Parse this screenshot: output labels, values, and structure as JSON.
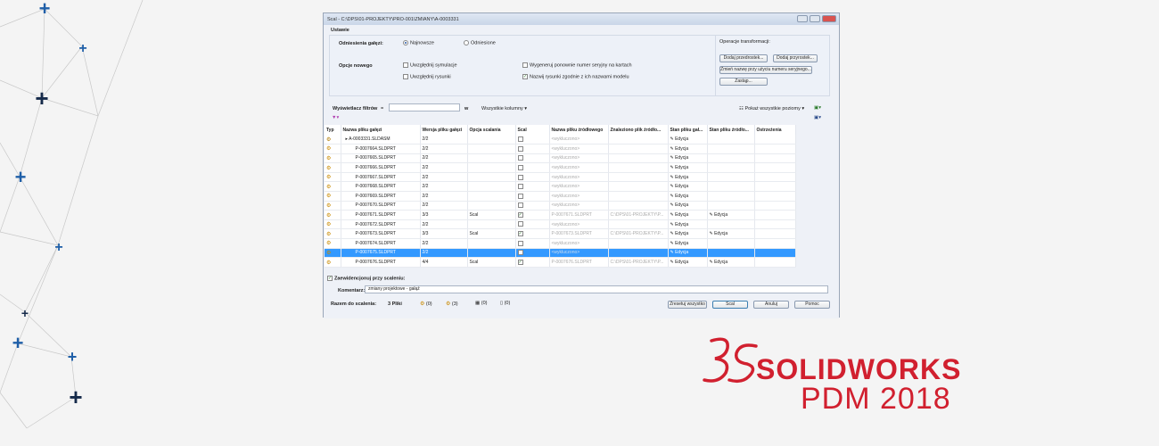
{
  "window": {
    "title": "Scal - C:\\DPS\\01-PROJEKTY\\PRO-001\\ZMIANY\\A-0003331"
  },
  "settings": {
    "header": "Ustawie",
    "branch_refs_label": "Odniesienia gałęzi:",
    "radio_latest": "Najnowsze",
    "radio_referenced": "Odniesione",
    "new_options_label": "Opcje nowego",
    "include_sim": "Uwzględnij symulacje",
    "include_drawings": "Uwzględnij rysunki",
    "regen_serial": "Wygeneruj ponownie numer seryjny na kartach",
    "name_drawings": "Nazwij rysunki zgodnie z ich nazwami modelu",
    "name_drawings_checked": true,
    "transform_label": "Operacje transformacji:",
    "add_prefix": "Dodaj przedrostek...",
    "add_suffix": "Dodaj przyrostek...",
    "rename_serial": "Zmień nazwę przy użyciu numeru seryjnego...",
    "replace": "Zastąp..."
  },
  "filter": {
    "label": "Wyświetlacz filtrów",
    "operator": "=",
    "value": "",
    "in_label": "w",
    "columns": "Wszystkie kolumny ▾",
    "show_levels": "Pokaż wszystkie poziomy ▾"
  },
  "table": {
    "headers": [
      "Typ",
      "Nazwa pliku gałęzi",
      "Wersja pliku gałęzi",
      "Opcja scalania",
      "Scal",
      "Nazwa pliku źródłowego",
      "Znaleziono plik źródło...",
      "Stan pliku gał...",
      "Stan pliku źródło...",
      "Ostrzeżenia"
    ],
    "rows": [
      {
        "name": "▸ A-0003331.SLDASM",
        "ver": "2/2",
        "opt": "",
        "merge": false,
        "src": "<wykluczono>",
        "found": "",
        "state": "Edycja",
        "srcstate": "",
        "asm": true
      },
      {
        "name": "P-0007664.SLDPRT",
        "ver": "2/2",
        "opt": "",
        "merge": false,
        "src": "<wykluczono>",
        "found": "",
        "state": "Edycja",
        "srcstate": ""
      },
      {
        "name": "P-0007665.SLDPRT",
        "ver": "2/2",
        "opt": "",
        "merge": false,
        "src": "<wykluczono>",
        "found": "",
        "state": "Edycja",
        "srcstate": ""
      },
      {
        "name": "P-0007666.SLDPRT",
        "ver": "2/2",
        "opt": "",
        "merge": false,
        "src": "<wykluczono>",
        "found": "",
        "state": "Edycja",
        "srcstate": ""
      },
      {
        "name": "P-0007667.SLDPRT",
        "ver": "2/2",
        "opt": "",
        "merge": false,
        "src": "<wykluczono>",
        "found": "",
        "state": "Edycja",
        "srcstate": ""
      },
      {
        "name": "P-0007668.SLDPRT",
        "ver": "2/2",
        "opt": "",
        "merge": false,
        "src": "<wykluczono>",
        "found": "",
        "state": "Edycja",
        "srcstate": ""
      },
      {
        "name": "P-0007669.SLDPRT",
        "ver": "2/2",
        "opt": "",
        "merge": false,
        "src": "<wykluczono>",
        "found": "",
        "state": "Edycja",
        "srcstate": ""
      },
      {
        "name": "P-0007670.SLDPRT",
        "ver": "2/2",
        "opt": "",
        "merge": false,
        "src": "<wykluczono>",
        "found": "",
        "state": "Edycja",
        "srcstate": ""
      },
      {
        "name": "P-0007671.SLDPRT",
        "ver": "3/3",
        "opt": "Scal",
        "merge": true,
        "src": "P-0007671.SLDPRT",
        "found": "C:\\DPS\\01-PROJEKTY\\P...",
        "state": "Edycja",
        "srcstate": "Edycja"
      },
      {
        "name": "P-0007672.SLDPRT",
        "ver": "2/2",
        "opt": "",
        "merge": false,
        "src": "<wykluczono>",
        "found": "",
        "state": "Edycja",
        "srcstate": ""
      },
      {
        "name": "P-0007673.SLDPRT",
        "ver": "3/3",
        "opt": "Scal",
        "merge": true,
        "src": "P-0007673.SLDPRT",
        "found": "C:\\DPS\\01-PROJEKTY\\P...",
        "state": "Edycja",
        "srcstate": "Edycja"
      },
      {
        "name": "P-0007674.SLDPRT",
        "ver": "2/2",
        "opt": "",
        "merge": false,
        "src": "<wykluczono>",
        "found": "",
        "state": "Edycja",
        "srcstate": ""
      },
      {
        "name": "P-0007675.SLDPRT",
        "ver": "2/2",
        "opt": "",
        "merge": false,
        "src": "<wykluczono>",
        "found": "",
        "state": "Edycja",
        "srcstate": "",
        "selected": true
      },
      {
        "name": "P-0007676.SLDPRT",
        "ver": "4/4",
        "opt": "Scal",
        "merge": true,
        "src": "P-0007676.SLDPRT",
        "found": "C:\\DPS\\01-PROJEKTY\\P...",
        "state": "Edycja",
        "srcstate": "Edycja"
      }
    ]
  },
  "footer": {
    "checkin_label": "Zaewidencjonuj przy scaleniu:",
    "checkin_checked": true,
    "comment_label": "Komentarz:",
    "comment_value": "zmiany projektowe - gałąź",
    "total_label": "Razem do scalenia:",
    "total_value": "3 Pliki",
    "counts": [
      "(0)",
      "(3)",
      "(0)",
      "(0)"
    ],
    "reset": "Zresetuj wszystko",
    "merge": "Scal",
    "cancel": "Anuluj",
    "help": "Pomoc"
  },
  "logo": {
    "brand": "SOLIDWORKS",
    "product": "PDM 2018",
    "colors": {
      "red": "#d1202f"
    }
  }
}
